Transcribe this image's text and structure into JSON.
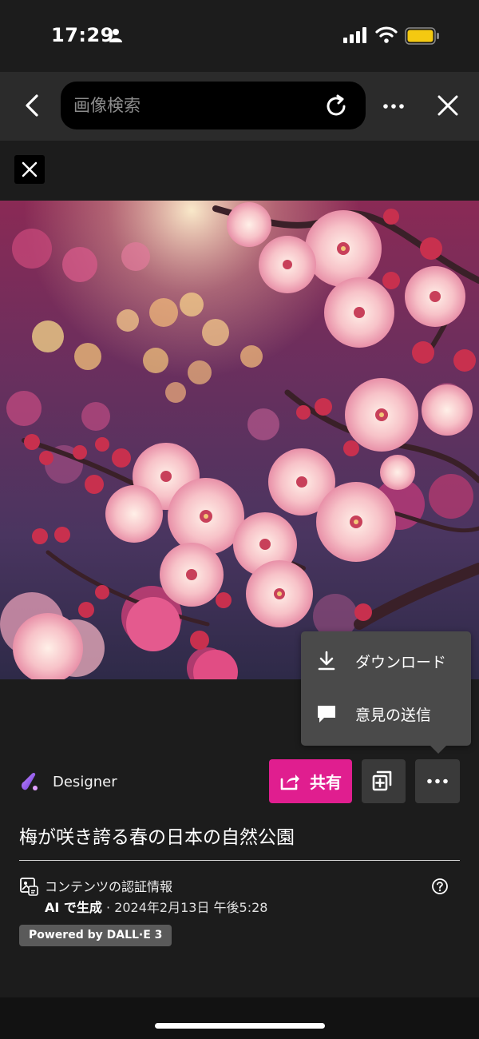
{
  "status_bar": {
    "time": "17:29",
    "icons": [
      "person-icon",
      "signal-icon",
      "wifi-icon",
      "battery-icon"
    ],
    "battery_color": "#f4c911"
  },
  "toolbar": {
    "search_placeholder": "画像検索",
    "icons": [
      "back-icon",
      "refresh-icon",
      "more-icon",
      "close-icon"
    ]
  },
  "image": {
    "subject": "plum blossoms"
  },
  "popup_menu": {
    "items": [
      {
        "label": "ダウンロード",
        "icon": "download-icon"
      },
      {
        "label": "意見の送信",
        "icon": "feedback-icon"
      }
    ]
  },
  "actions": {
    "brand_label": "Designer",
    "share_label": "共有",
    "share_color": "#e01e8f"
  },
  "info": {
    "title": "梅が咲き誇る春の日本の自然公園",
    "credentials_title": "コンテンツの認証情報",
    "ai_generated": "AI で生成",
    "separator": " · ",
    "date": "2024年2月13日 午後5:28",
    "powered_by": "Powered by DALL·E 3"
  }
}
